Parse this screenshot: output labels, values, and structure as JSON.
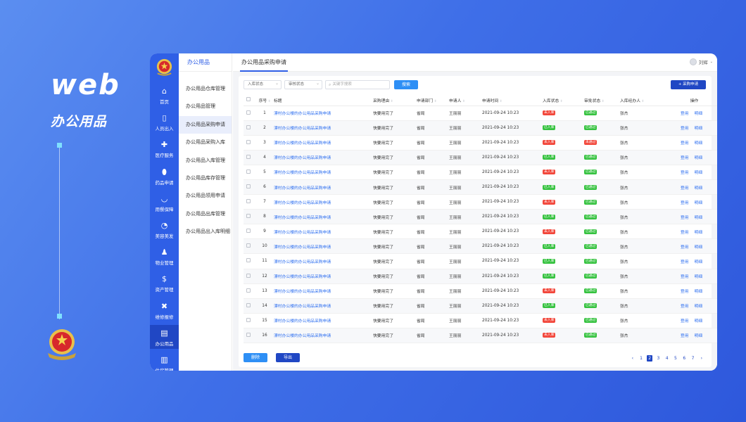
{
  "promo": {
    "title": "web",
    "subtitle": "办公用品"
  },
  "colors": {
    "primary": "#2f5fe6",
    "dark": "#2047c4",
    "green": "#35c23f",
    "red": "#f2463a"
  },
  "navbar": {
    "items": [
      {
        "label": "首页",
        "icon": "home-icon"
      },
      {
        "label": "人员出入",
        "icon": "door-icon"
      },
      {
        "label": "医疗服务",
        "icon": "medkit-icon"
      },
      {
        "label": "药品申请",
        "icon": "pill-icon"
      },
      {
        "label": "用餐保障",
        "icon": "bowl-icon"
      },
      {
        "label": "美容美发",
        "icon": "hairdresser-icon"
      },
      {
        "label": "物业管理",
        "icon": "person-icon"
      },
      {
        "label": "资产管理",
        "icon": "money-icon"
      },
      {
        "label": "维修报修",
        "icon": "tools-icon"
      },
      {
        "label": "办公用品",
        "icon": "printer-icon"
      },
      {
        "label": "住房管理",
        "icon": "building-icon"
      }
    ],
    "active_index": 9
  },
  "subnav": {
    "title": "办公用品",
    "items": [
      "办公用品仓库管理",
      "办公用品管理",
      "办公用品采购申请",
      "办公用品采购入库",
      "办公用品入库管理",
      "办公用品库存管理",
      "办公用品领用申请",
      "办公用品出库管理",
      "办公用品出入库明细"
    ],
    "active_index": 2
  },
  "topbar": {
    "tab": "办公用品采购申请",
    "user": "刘辉"
  },
  "filters": {
    "status1": "入库状态",
    "status2": "审核状态",
    "search_placeholder": "关键字搜索",
    "search_button": "搜索",
    "add_button": "+ 采购申请"
  },
  "table": {
    "headers": [
      "序号",
      "标题",
      "采购理由",
      "申请部门",
      "申请人",
      "申请时间",
      "入库状态",
      "审批状态",
      "入库经办人",
      "操作"
    ],
    "title": "漂村办公楼的办公用品采购申请",
    "reason": "快要用完了",
    "dept": "省局",
    "applicant": "王丽丽",
    "time": "2021-09-24 10:23",
    "handler": "张杰",
    "ops": [
      "登用",
      "明细"
    ],
    "rows": [
      {
        "no": "1",
        "in": "未入库",
        "appr": "已通过"
      },
      {
        "no": "2",
        "in": "已入库",
        "appr": "已通过"
      },
      {
        "no": "3",
        "in": "未入库",
        "appr": "未通过"
      },
      {
        "no": "4",
        "in": "已入库",
        "appr": "已通过"
      },
      {
        "no": "5",
        "in": "未入库",
        "appr": "已通过"
      },
      {
        "no": "6",
        "in": "已入库",
        "appr": "已通过"
      },
      {
        "no": "7",
        "in": "未入库",
        "appr": "已通过"
      },
      {
        "no": "8",
        "in": "已入库",
        "appr": "已通过"
      },
      {
        "no": "9",
        "in": "未入库",
        "appr": "已通过"
      },
      {
        "no": "10",
        "in": "已入库",
        "appr": "已通过"
      },
      {
        "no": "11",
        "in": "已入库",
        "appr": "已通过"
      },
      {
        "no": "12",
        "in": "已入库",
        "appr": "已通过"
      },
      {
        "no": "13",
        "in": "未入库",
        "appr": "已通过"
      },
      {
        "no": "14",
        "in": "已入库",
        "appr": "已通过"
      },
      {
        "no": "15",
        "in": "未入库",
        "appr": "已通过"
      },
      {
        "no": "16",
        "in": "未入库",
        "appr": "已通过"
      }
    ]
  },
  "footer": {
    "delete": "删除",
    "export": "导出"
  },
  "pager": {
    "prev": "‹",
    "pages": [
      "1",
      "2",
      "3",
      "4",
      "5",
      "6",
      "7"
    ],
    "active": "2",
    "next": "›"
  }
}
